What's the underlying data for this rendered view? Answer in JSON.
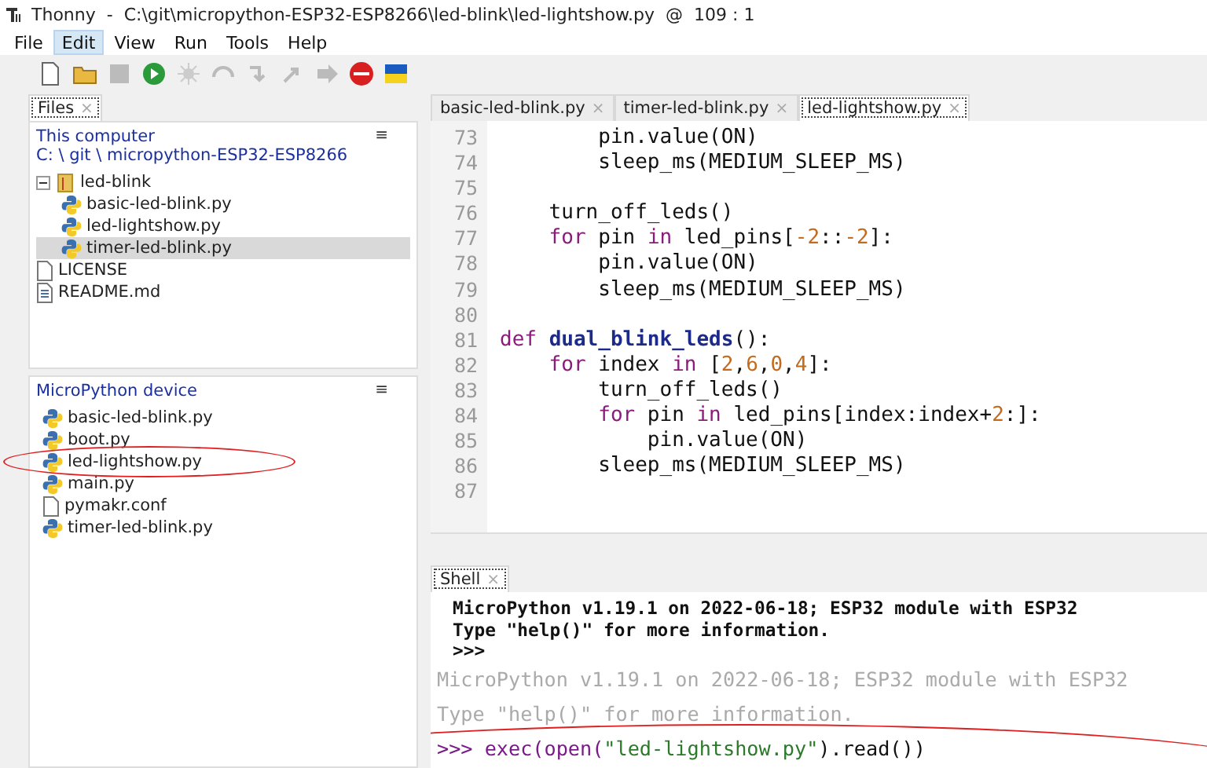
{
  "window": {
    "title": "Thonny  -  C:\\git\\micropython-ESP32-ESP8266\\led-blink\\led-lightshow.py  @  109 : 1"
  },
  "menu": [
    {
      "label": "File",
      "selected": false
    },
    {
      "label": "Edit",
      "selected": true
    },
    {
      "label": "View",
      "selected": false
    },
    {
      "label": "Run",
      "selected": false
    },
    {
      "label": "Tools",
      "selected": false
    },
    {
      "label": "Help",
      "selected": false
    }
  ],
  "files_panel": {
    "tab": "Files",
    "close": "×",
    "computer": {
      "header": "This computer",
      "path": "C: \\ git \\ micropython-ESP32-ESP8266",
      "menu": "≡",
      "items": [
        {
          "name": "led-blink",
          "kind": "folder",
          "expanded": true,
          "selected": false,
          "children": [
            {
              "name": "basic-led-blink.py",
              "kind": "python",
              "selected": false
            },
            {
              "name": "led-lightshow.py",
              "kind": "python",
              "selected": false
            },
            {
              "name": "timer-led-blink.py",
              "kind": "python",
              "selected": true
            }
          ]
        },
        {
          "name": "LICENSE",
          "kind": "file",
          "selected": false
        },
        {
          "name": "README.md",
          "kind": "text",
          "selected": false
        }
      ]
    },
    "device": {
      "header": "MicroPython device",
      "menu": "≡",
      "items": [
        {
          "name": "basic-led-blink.py",
          "kind": "python",
          "circled": false
        },
        {
          "name": "boot.py",
          "kind": "python",
          "circled": false
        },
        {
          "name": "led-lightshow.py",
          "kind": "python",
          "circled": true
        },
        {
          "name": "main.py",
          "kind": "python",
          "circled": false
        },
        {
          "name": "pymakr.conf",
          "kind": "file",
          "circled": false
        },
        {
          "name": "timer-led-blink.py",
          "kind": "python",
          "circled": false
        }
      ]
    }
  },
  "editor": {
    "tabs": [
      {
        "label": "basic-led-blink.py",
        "selected": false
      },
      {
        "label": "timer-led-blink.py",
        "selected": false
      },
      {
        "label": "led-lightshow.py",
        "selected": true
      }
    ],
    "close": "×",
    "lines": [
      {
        "number": "73",
        "tokens": [
          {
            "text": "        pin.value(ON)",
            "kind": "plain"
          }
        ]
      },
      {
        "number": "74",
        "tokens": [
          {
            "text": "        sleep_ms(MEDIUM_SLEEP_MS)",
            "kind": "plain"
          }
        ]
      },
      {
        "number": "75"
      },
      {
        "number": "76",
        "tokens": [
          {
            "text": "    turn_off_leds()",
            "kind": "plain"
          }
        ]
      },
      {
        "number": "77",
        "tokens": [
          {
            "text": "    for",
            "kind": "keyword"
          },
          {
            "text": " pin ",
            "kind": "plain"
          },
          {
            "text": "in",
            "kind": "keyword"
          },
          {
            "text": " led_pins[",
            "kind": "plain"
          },
          {
            "text": "-2",
            "kind": "number"
          },
          {
            "text": "::",
            "kind": "plain"
          },
          {
            "text": "-2",
            "kind": "number"
          },
          {
            "text": "]:",
            "kind": "plain"
          }
        ]
      },
      {
        "number": "78",
        "tokens": [
          {
            "text": "        pin.value(ON)",
            "kind": "plain"
          }
        ]
      },
      {
        "number": "79",
        "tokens": [
          {
            "text": "        sleep_ms(MEDIUM_SLEEP_MS)",
            "kind": "plain"
          }
        ]
      },
      {
        "number": "80"
      },
      {
        "number": "81",
        "tokens": [
          {
            "text": "def ",
            "kind": "keyword"
          },
          {
            "text": "dual_blink_leds",
            "kind": "defname"
          },
          {
            "text": "():",
            "kind": "plain"
          }
        ]
      },
      {
        "number": "82",
        "tokens": [
          {
            "text": "    for",
            "kind": "keyword"
          },
          {
            "text": " index ",
            "kind": "plain"
          },
          {
            "text": "in",
            "kind": "keyword"
          },
          {
            "text": " [",
            "kind": "plain"
          },
          {
            "text": "2",
            "kind": "number"
          },
          {
            "text": ",",
            "kind": "plain"
          },
          {
            "text": "6",
            "kind": "number"
          },
          {
            "text": ",",
            "kind": "plain"
          },
          {
            "text": "0",
            "kind": "number"
          },
          {
            "text": ",",
            "kind": "plain"
          },
          {
            "text": "4",
            "kind": "number"
          },
          {
            "text": "]:",
            "kind": "plain"
          }
        ]
      },
      {
        "number": "83",
        "tokens": [
          {
            "text": "        turn_off_leds()",
            "kind": "plain"
          }
        ]
      },
      {
        "number": "84",
        "tokens": [
          {
            "text": "        for",
            "kind": "keyword"
          },
          {
            "text": " pin ",
            "kind": "plain"
          },
          {
            "text": "in",
            "kind": "keyword"
          },
          {
            "text": " led_pins[index:index+",
            "kind": "plain"
          },
          {
            "text": "2",
            "kind": "number"
          },
          {
            "text": ":]:",
            "kind": "plain"
          }
        ]
      },
      {
        "number": "85",
        "tokens": [
          {
            "text": "            pin.value(ON)",
            "kind": "plain"
          }
        ]
      },
      {
        "number": "86",
        "tokens": [
          {
            "text": "        sleep_ms(MEDIUM_SLEEP_MS)",
            "kind": "plain"
          }
        ]
      },
      {
        "number": "87"
      }
    ]
  },
  "shell": {
    "tab": "Shell",
    "close": "×",
    "lines": [
      {
        "kind": "banner",
        "text": "MicroPython v1.19.1 on 2022-06-18; ESP32 module with ESP32"
      },
      {
        "kind": "banner",
        "text": "Type \"help()\" for more information."
      },
      {
        "kind": "banner",
        "text": ">>>"
      },
      {
        "kind": "faded",
        "text": "MicroPython v1.19.1 on 2022-06-18; ESP32 module with ESP32"
      },
      {
        "kind": "faded",
        "text": "Type \"help()\" for more information."
      },
      {
        "kind": "command",
        "prompt": ">>>",
        "call": "exec(open(",
        "string": "\"led-lightshow.py\"",
        "rest": ").read())",
        "circled": true
      }
    ]
  }
}
